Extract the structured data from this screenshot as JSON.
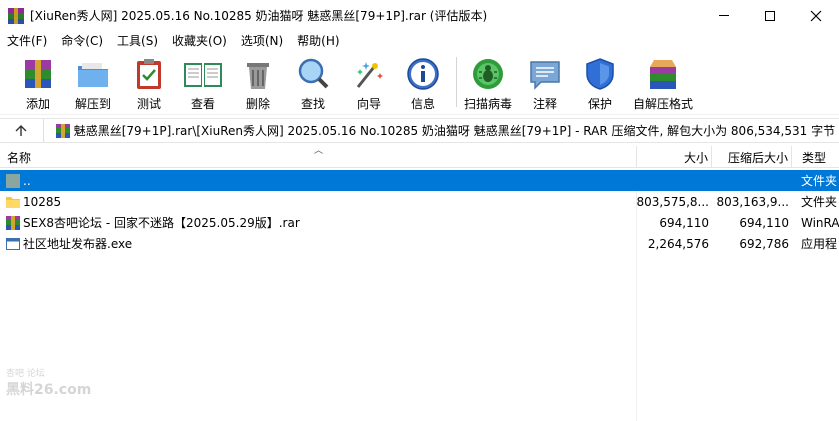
{
  "window": {
    "title": "[XiuRen秀人网] 2025.05.16 No.10285 奶油猫呀 魅惑黑丝[79+1P].rar (评估版本)"
  },
  "menu": [
    "文件(F)",
    "命令(C)",
    "工具(S)",
    "收藏夹(O)",
    "选项(N)",
    "帮助(H)"
  ],
  "toolbar": {
    "add": "添加",
    "extract": "解压到",
    "test": "测试",
    "view": "查看",
    "delete": "删除",
    "find": "查找",
    "wizard": "向导",
    "info": "信息",
    "scan": "扫描病毒",
    "comment": "注释",
    "protect": "保护",
    "sfx": "自解压格式"
  },
  "address": {
    "path": "魅惑黑丝[79+1P].rar\\[XiuRen秀人网] 2025.05.16 No.10285 奶油猫呀 魅惑黑丝[79+1P] - RAR 压缩文件, 解包大小为 806,534,531 字节"
  },
  "columns": {
    "name": "名称",
    "size": "大小",
    "packed": "压缩后大小",
    "type": "类型"
  },
  "files": [
    {
      "name": "..",
      "size": "",
      "packed": "",
      "type": "文件夹",
      "icon": "parent-folder-icon"
    },
    {
      "name": "10285",
      "size": "803,575,8...",
      "packed": "803,163,9...",
      "type": "文件夹",
      "icon": "folder-icon"
    },
    {
      "name": "SEX8杏吧论坛 - 回家不迷路【2025.05.29版】.rar",
      "size": "694,110",
      "packed": "694,110",
      "type": "WinRA",
      "icon": "rar-archive-icon"
    },
    {
      "name": "社区地址发布器.exe",
      "size": "2,264,576",
      "packed": "692,786",
      "type": "应用程",
      "icon": "exe-icon"
    }
  ],
  "watermark": {
    "top": "杏吧 论坛",
    "bottom": "黑料26.com"
  }
}
